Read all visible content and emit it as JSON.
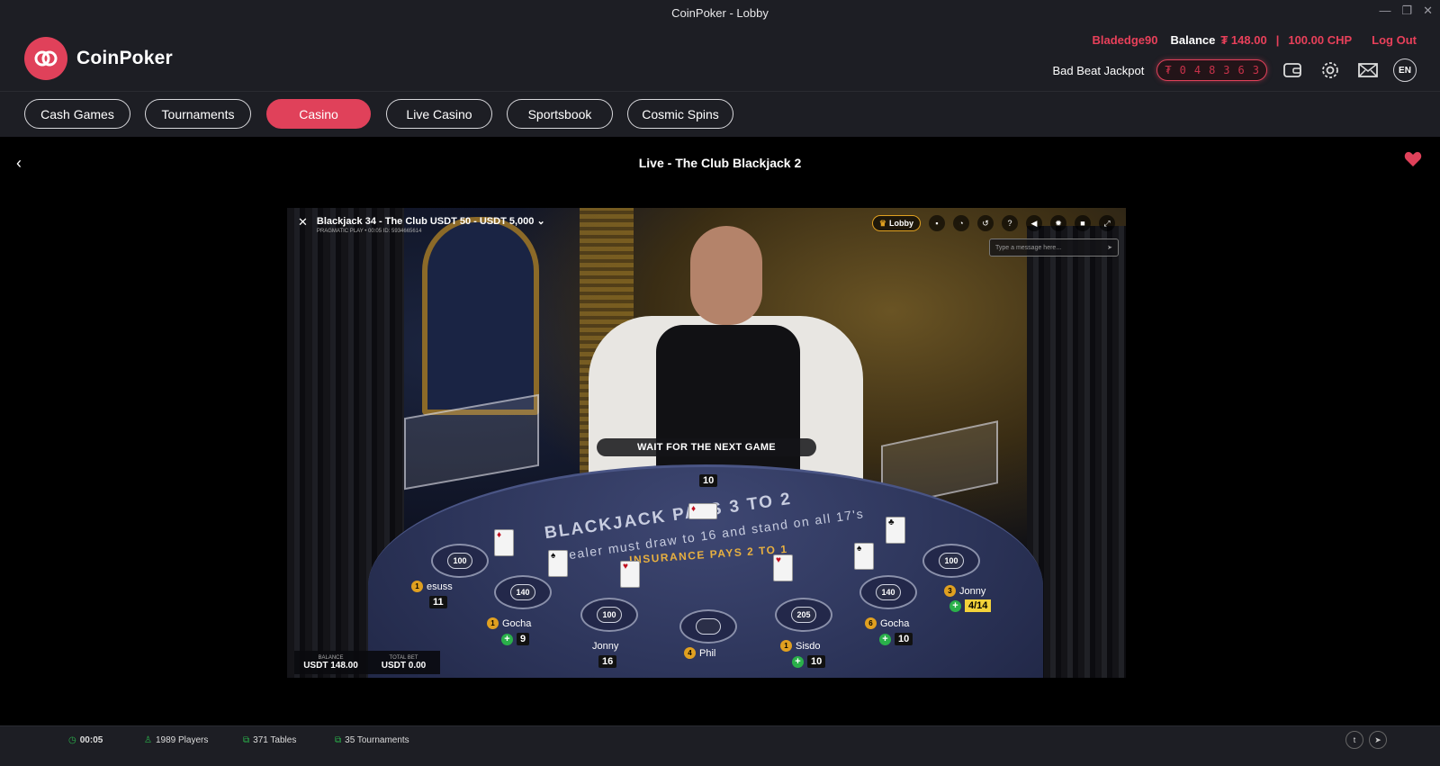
{
  "window": {
    "title": "CoinPoker - Lobby"
  },
  "brand": {
    "name": "CoinPoker",
    "accent": "#e0415a"
  },
  "user": {
    "username": "Bladedge90",
    "balance_label": "Balance",
    "balance_value": "₮ 148.00",
    "separator": "|",
    "chp_value": "100.00 CHP",
    "logout_label": "Log Out"
  },
  "jackpot": {
    "label": "Bad Beat Jackpot",
    "digits": [
      "₮",
      "0",
      "4",
      "8",
      "3",
      "6",
      "3"
    ]
  },
  "header_icons": [
    "wallet-icon",
    "gear-icon",
    "mail-icon"
  ],
  "language": "EN",
  "nav": [
    {
      "label": "Cash Games",
      "active": false
    },
    {
      "label": "Tournaments",
      "active": false
    },
    {
      "label": "Casino",
      "active": true
    },
    {
      "label": "Live Casino",
      "active": false
    },
    {
      "label": "Sportsbook",
      "active": false
    },
    {
      "label": "Cosmic Spins",
      "active": false
    }
  ],
  "game": {
    "title": "Live - The Club Blackjack 2",
    "stream": {
      "table_name": "Blackjack 34 - The Club USDT 50 - USDT 5,000",
      "subline": "PRAGMATIC PLAY • 00:05 ID: 5934665614",
      "lobby_label": "Lobby",
      "chat_placeholder": "Type a message here...",
      "banner": "WAIT FOR THE NEXT GAME",
      "dealer_count": "10",
      "table_line1": "BLACKJACK PAYS 3 TO 2",
      "table_line2": "Dealer must draw to 16 and stand on all 17's",
      "table_line3": "INSURANCE PAYS 2 TO 1",
      "seats": [
        {
          "chip": "100"
        },
        {
          "chip": "140"
        },
        {
          "chip": "100"
        },
        {
          "chip": ""
        },
        {
          "chip": "205"
        },
        {
          "chip": "140"
        },
        {
          "chip": "100"
        }
      ],
      "players": [
        {
          "rank": "1",
          "name": "esuss",
          "score": "11"
        },
        {
          "rank": "1",
          "name": "Gocha",
          "score": "9"
        },
        {
          "rank": "",
          "name": "Jonny",
          "score": "16"
        },
        {
          "rank": "4",
          "name": "Phil",
          "score": ""
        },
        {
          "rank": "1",
          "name": "Sisdo",
          "score": "10"
        },
        {
          "rank": "6",
          "name": "Gocha",
          "score": "10"
        },
        {
          "rank": "3",
          "name": "Jonny",
          "score": "4/14"
        }
      ],
      "balance_label": "BALANCE",
      "balance_value": "USDT 148.00",
      "totalbet_label": "TOTAL BET",
      "totalbet_value": "USDT 0.00"
    }
  },
  "status": {
    "time": "00:05",
    "players": "1989 Players",
    "tables": "371 Tables",
    "tournaments": "35 Tournaments"
  }
}
